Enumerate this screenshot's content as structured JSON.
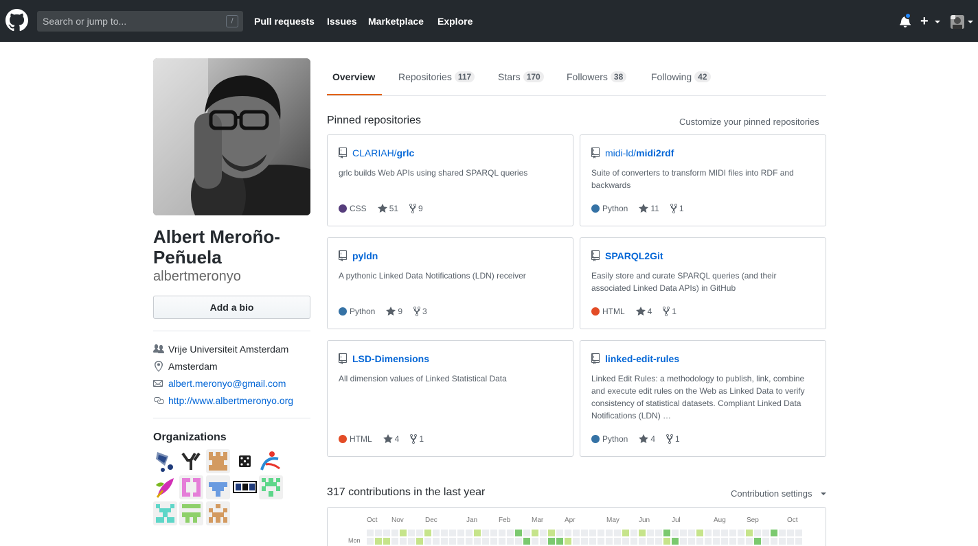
{
  "header": {
    "search_placeholder": "Search or jump to...",
    "slash_key": "/",
    "nav": [
      "Pull requests",
      "Issues",
      "Marketplace",
      "Explore"
    ],
    "plus_label": "+"
  },
  "profile": {
    "name": "Albert Meroño-Peñuela",
    "login": "albertmeronyo",
    "bio_button": "Add a bio",
    "organization": "Vrije Universiteit Amsterdam",
    "location": "Amsterdam",
    "email": "albert.meronyo@gmail.com",
    "website": "http://www.albertmeronyo.org",
    "organizations_title": "Organizations"
  },
  "tabs": [
    {
      "label": "Overview",
      "count": ""
    },
    {
      "label": "Repositories",
      "count": "117"
    },
    {
      "label": "Stars",
      "count": "170"
    },
    {
      "label": "Followers",
      "count": "38"
    },
    {
      "label": "Following",
      "count": "42"
    }
  ],
  "pinned": {
    "title": "Pinned repositories",
    "customize": "Customize your pinned repositories",
    "repos": [
      {
        "owner": "CLARIAH/",
        "name": "grlc",
        "desc": "grlc builds Web APIs using shared SPARQL queries",
        "lang": "CSS",
        "lang_color": "#563d7c",
        "stars": "51",
        "forks": "9"
      },
      {
        "owner": "midi-ld/",
        "name": "midi2rdf",
        "desc": "Suite of converters to transform MIDI files into RDF and backwards",
        "lang": "Python",
        "lang_color": "#3572A5",
        "stars": "11",
        "forks": "1"
      },
      {
        "owner": "",
        "name": "pyldn",
        "desc": "A pythonic Linked Data Notifications (LDN) receiver",
        "lang": "Python",
        "lang_color": "#3572A5",
        "stars": "9",
        "forks": "3"
      },
      {
        "owner": "",
        "name": "SPARQL2Git",
        "desc": "Easily store and curate SPARQL queries (and their associated Linked Data APIs) in GitHub",
        "lang": "HTML",
        "lang_color": "#e34c26",
        "stars": "4",
        "forks": "1"
      },
      {
        "owner": "",
        "name": "LSD-Dimensions",
        "desc": "All dimension values of Linked Statistical Data",
        "lang": "HTML",
        "lang_color": "#e34c26",
        "stars": "4",
        "forks": "1"
      },
      {
        "owner": "",
        "name": "linked-edit-rules",
        "desc": "Linked Edit Rules: a methodology to publish, link, combine and execute edit rules on the Web as Linked Data to verify consistency of statistical datasets. Compliant Linked Data Notifications (LDN) …",
        "lang": "Python",
        "lang_color": "#3572A5",
        "stars": "4",
        "forks": "1"
      }
    ]
  },
  "contributions": {
    "title": "317 contributions in the last year",
    "settings": "Contribution settings",
    "months": [
      "Oct",
      "Nov",
      "Dec",
      "Jan",
      "Feb",
      "Mar",
      "Apr",
      "May",
      "Jun",
      "Jul",
      "Aug",
      "Sep",
      "Oct"
    ],
    "day_label": "Mon",
    "levels": [
      0,
      1,
      1,
      0,
      0,
      0,
      1,
      0,
      0,
      0,
      0,
      0,
      0,
      0,
      0,
      0,
      0,
      0,
      0,
      2,
      0,
      0,
      2,
      2,
      1,
      0,
      0,
      0,
      0,
      0,
      0,
      0,
      0,
      0,
      0,
      0,
      1,
      2,
      0,
      0,
      0,
      0,
      0,
      0,
      0,
      0,
      0,
      2,
      0,
      0,
      0,
      0,
      0,
      1,
      0,
      0,
      0,
      1,
      3,
      2,
      1,
      1
    ]
  }
}
